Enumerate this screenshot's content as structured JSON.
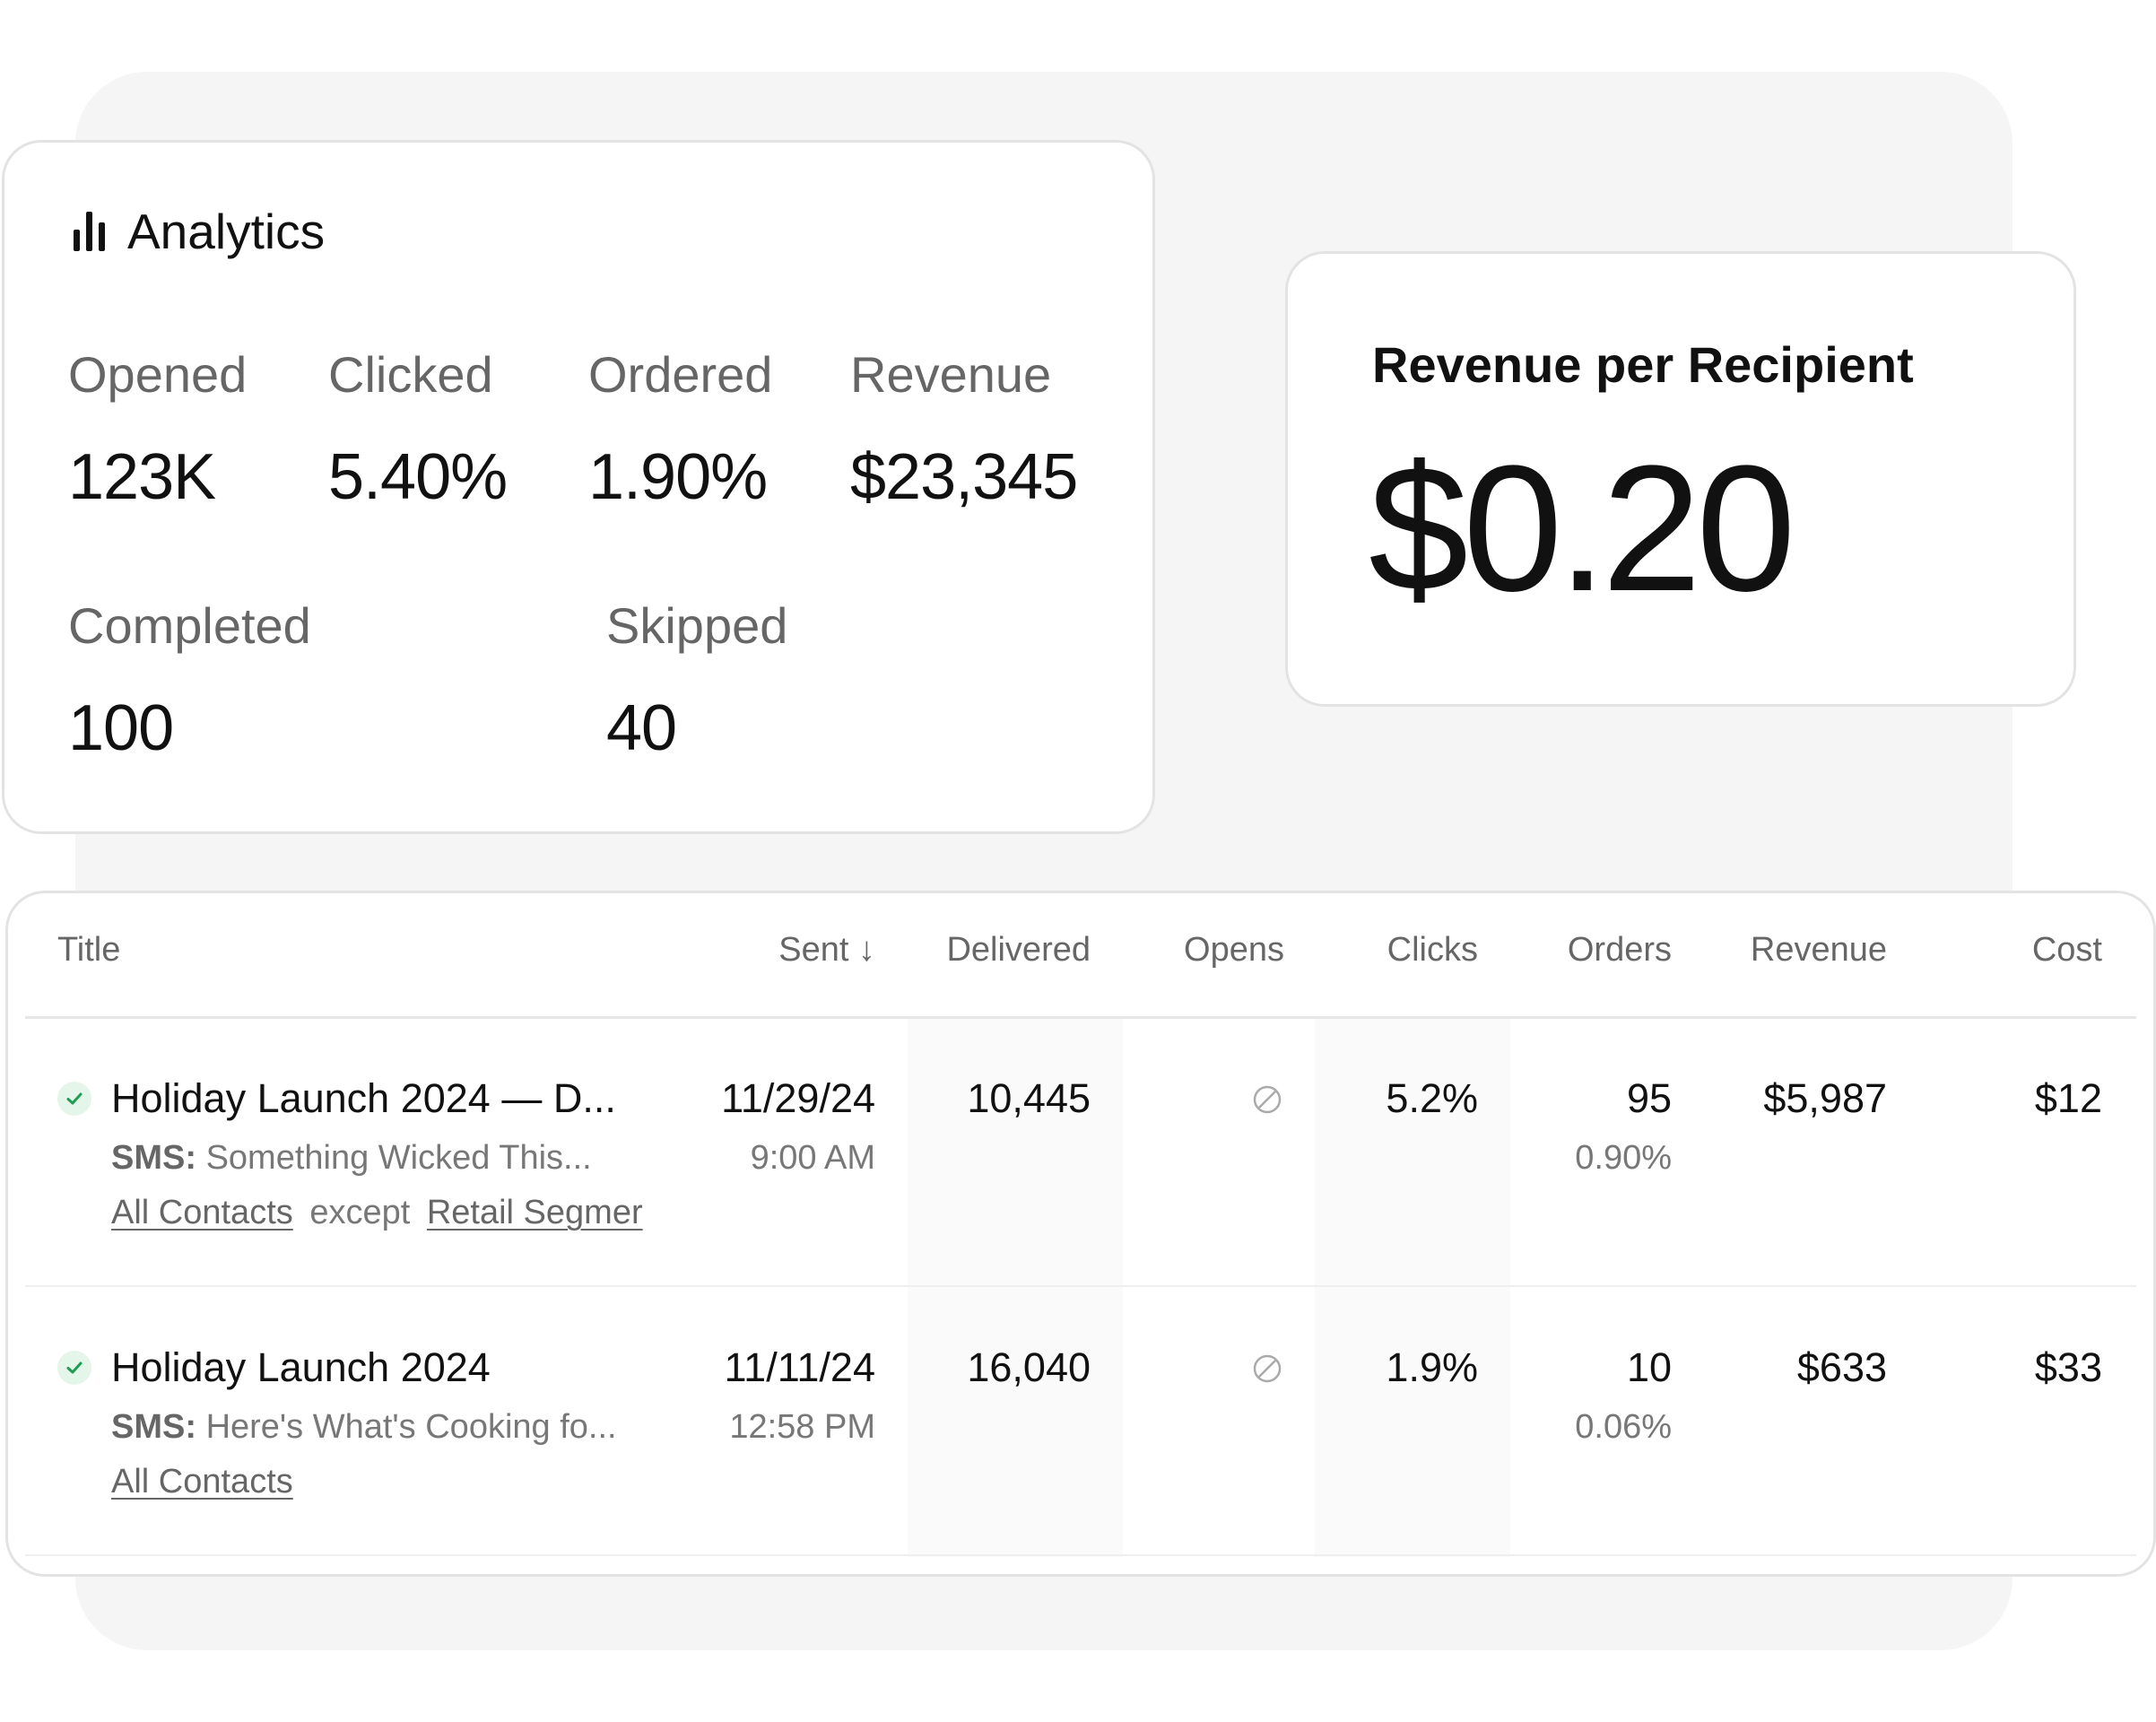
{
  "analytics": {
    "title": "Analytics",
    "metrics": [
      {
        "label": "Opened",
        "value": "123K"
      },
      {
        "label": "Clicked",
        "value": "5.40%"
      },
      {
        "label": "Ordered",
        "value": "1.90%"
      },
      {
        "label": "Revenue",
        "value": "$23,345"
      },
      {
        "label": "Completed",
        "value": "100"
      },
      {
        "label": "Skipped",
        "value": "40"
      }
    ]
  },
  "revenue_per_recipient": {
    "label": "Revenue per Recipient",
    "value": "$0.20"
  },
  "table": {
    "columns": [
      "Title",
      "Sent ↓",
      "Delivered",
      "Opens",
      "Clicks",
      "Orders",
      "Revenue",
      "Cost"
    ],
    "rows": [
      {
        "title": "Holiday Launch 2024 — D...",
        "channel": "SMS:",
        "message": "Something Wicked This...",
        "audience": "All Contacts",
        "except_word": "except",
        "excluded": "Retail Segmer",
        "sent_date": "11/29/24",
        "sent_time": "9:00 AM",
        "delivered": "10,445",
        "clicks": "5.2%",
        "orders": "95",
        "orders_rate": "0.90%",
        "revenue": "$5,987",
        "cost": "$12"
      },
      {
        "title": "Holiday Launch 2024",
        "channel": "SMS:",
        "message": "Here's What's Cooking fo...",
        "audience": "All Contacts",
        "sent_date": "11/11/24",
        "sent_time": "12:58 PM",
        "delivered": "16,040",
        "clicks": "1.9%",
        "orders": "10",
        "orders_rate": "0.06%",
        "revenue": "$633",
        "cost": "$33"
      }
    ]
  },
  "colors": {
    "status_green": "#1f9d55",
    "status_green_bg": "#e4f5e9"
  },
  "icons": [
    "bar-chart-icon",
    "check-circle-icon",
    "no-data-icon",
    "arrow-down-icon"
  ]
}
